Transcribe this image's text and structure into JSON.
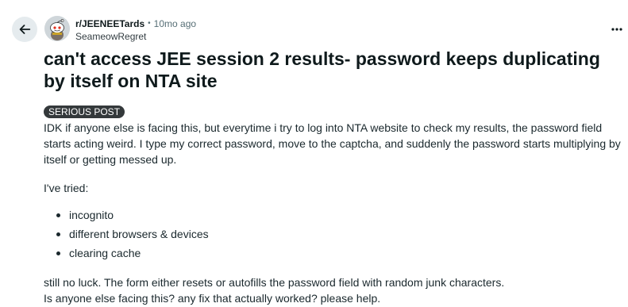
{
  "post": {
    "subreddit": "r/JEENEETards",
    "separator": "•",
    "time_ago": "10mo ago",
    "author": "SeameowRegret",
    "title": "can't access JEE session 2 results- password keeps duplicating by itself on NTA site",
    "flair": "SERIOUS POST",
    "body_para1": "IDK if anyone else is facing this, but everytime i try to log into NTA website to check my results, the password field starts acting weird. I type my correct password, move to the captcha, and suddenly the password starts multiplying by itself or getting messed up.",
    "body_tried": "I've tried:",
    "bullets": [
      "incognito",
      "different browsers & devices",
      "clearing cache"
    ],
    "body_line_a": "still no luck. The form either resets or autofills the password field with random junk characters.",
    "body_line_b": "Is anyone else facing this? any fix that actually worked? please help."
  },
  "icons": {
    "back": "arrow-left-icon",
    "more": "more-horizontal-icon",
    "avatar": "snoo-avatar-icon"
  },
  "colors": {
    "back_button_bg": "#e5ebee",
    "flair_bg": "#34393b",
    "meta_gray": "#576f76"
  }
}
